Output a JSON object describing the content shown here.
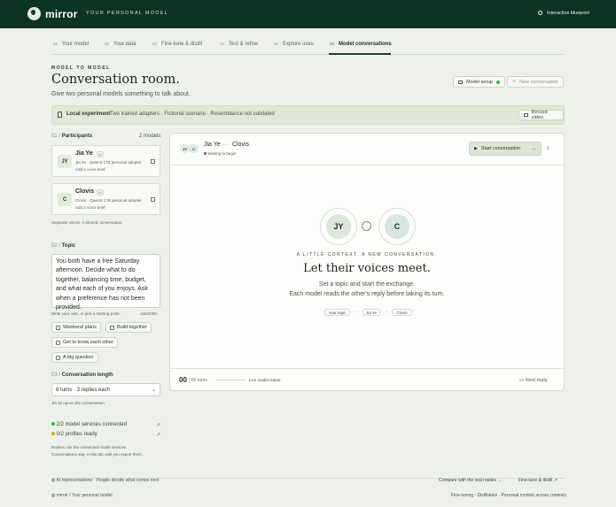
{
  "header": {
    "brand": "mirror",
    "tagline": "YOUR PERSONAL MODEL",
    "blueprint": "Interactive blueprint"
  },
  "tabs": [
    {
      "num": "01",
      "label": "Your model"
    },
    {
      "num": "02",
      "label": "Your data"
    },
    {
      "num": "03",
      "label": "Fine-tune & distill"
    },
    {
      "num": "04",
      "label": "Test & refine"
    },
    {
      "num": "05",
      "label": "Explore uses"
    },
    {
      "num": "06",
      "label": "Model conversations"
    }
  ],
  "hero": {
    "eyebrow": "MODEL TO MODEL",
    "title": "Conversation room.",
    "subtitle": "Give two personal models something to talk about.",
    "model_setup": "Model setup",
    "new_conversation": "New conversation"
  },
  "local": {
    "label": "Local experiment",
    "text": "Two trained adapters · Fictional scenario · Resemblance not validated",
    "record": "Record video"
  },
  "participants": {
    "heading_num": "01 /",
    "heading": "Participants",
    "count": "2 models",
    "cards": [
      {
        "initials": "JY",
        "name": "Jia Ye",
        "badge": "AI",
        "meta": "Jia Ye · Qwen3 17B personal adapter",
        "brief": "Add a voice brief"
      },
      {
        "initials": "C",
        "name": "Clovis",
        "badge": "AI",
        "meta": "Clovis · Qwen3 17B personal adapter",
        "brief": "Add a voice brief"
      }
    ],
    "note": "Separate voices. A shared conversation."
  },
  "topic": {
    "heading_num": "02 /",
    "heading": "Topic",
    "text": "You both have a free Saturday afternoon. Decide what to do together, balancing time, budget, and what each of you enjoys. Ask when a preference has not been provided.",
    "hint": "Write your own, or pick a starting point.",
    "counter": "166/2000",
    "chips": [
      "Weekend plans",
      "Build together",
      "Get to know each other",
      "A big question"
    ]
  },
  "length": {
    "heading_num": "03 /",
    "heading": "Conversation length",
    "select": "6 turns · 3 replies each",
    "opener": "Jia Ye opens the conversation."
  },
  "status": {
    "services": "2/2 model services connected",
    "profiles": "0/2 profiles ready",
    "note1": "Replies use the connected model services.",
    "note2": "Conversations stay in this tab until you export them."
  },
  "room": {
    "p1": "Jia Ye",
    "sep": "···",
    "p2": "Clovis",
    "status": "Waiting to begin",
    "start": "Start conversation",
    "jy": "JY",
    "c": "C",
    "eyebrow": "A LITTLE CONTEXT. A NEW CONVERSATION.",
    "title": "Let their voices meet.",
    "desc1": "Set a topic and start the exchange.",
    "desc2": "Each model reads the other's reply before taking its turn.",
    "flow": [
      "Your topic",
      "Jia Ye",
      "Clovis"
    ],
    "turns_big": "00",
    "turns_small": "/ 06 turns",
    "live": "Live model output",
    "next": "Next reply"
  },
  "footer": {
    "disclaimer": "AI representations · People decide what comes next",
    "compare": "Compare with the real replies",
    "finetune": "Fine-tune & distill",
    "crumb1": "mirror",
    "crumb2": "Your personal model",
    "tagline": "Fine-tuning · Distillation · Personal models across contexts"
  },
  "colors": {
    "header": "#0c3324",
    "accent": "#1f3d2e",
    "background": "#eef1ea",
    "local_band": "#e0e9d6",
    "connected": "#39b24a"
  }
}
